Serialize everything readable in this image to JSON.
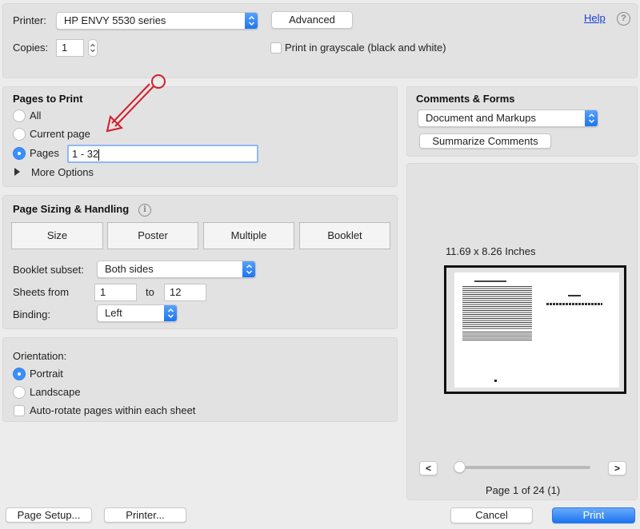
{
  "printer": {
    "label": "Printer:",
    "value": "HP ENVY 5530 series",
    "advanced_label": "Advanced",
    "help_label": "Help",
    "help_icon": "question-circle-icon"
  },
  "copies": {
    "label": "Copies:",
    "value": "1",
    "grayscale_label": "Print in grayscale (black and white)",
    "grayscale_checked": false
  },
  "pages_to_print": {
    "heading": "Pages to Print",
    "options": [
      {
        "label": "All",
        "selected": false
      },
      {
        "label": "Current page",
        "selected": false
      },
      {
        "label": "Pages",
        "selected": true
      }
    ],
    "pages_value": "1 - 32",
    "more_options_label": "More Options",
    "annotation_color": "#d0202a"
  },
  "page_sizing": {
    "heading": "Page Sizing & Handling",
    "info_icon": "info-icon",
    "modes": [
      "Size",
      "Poster",
      "Multiple",
      "Booklet"
    ],
    "booklet_subset_label": "Booklet subset:",
    "booklet_subset_value": "Both sides",
    "sheets_from_label": "Sheets from",
    "sheets_from_value": "1",
    "sheets_to_label": "to",
    "sheets_to_value": "12",
    "binding_label": "Binding:",
    "binding_value": "Left"
  },
  "orientation": {
    "heading": "Orientation:",
    "options": [
      {
        "label": "Portrait",
        "selected": true
      },
      {
        "label": "Landscape",
        "selected": false
      }
    ],
    "auto_rotate_label": "Auto-rotate pages within each sheet",
    "auto_rotate_checked": false
  },
  "comments_forms": {
    "heading": "Comments & Forms",
    "value": "Document and Markups",
    "summarize_label": "Summarize Comments"
  },
  "preview": {
    "size_label": "11.69 x 8.26 Inches",
    "prev_label": "<",
    "next_label": ">",
    "slider_value_fraction": 0.0,
    "page_status": "Page 1 of 24 (1)"
  },
  "footer": {
    "page_setup_label": "Page Setup...",
    "printer_label": "Printer...",
    "cancel_label": "Cancel",
    "print_label": "Print",
    "accent_color": "#1b74f1"
  }
}
